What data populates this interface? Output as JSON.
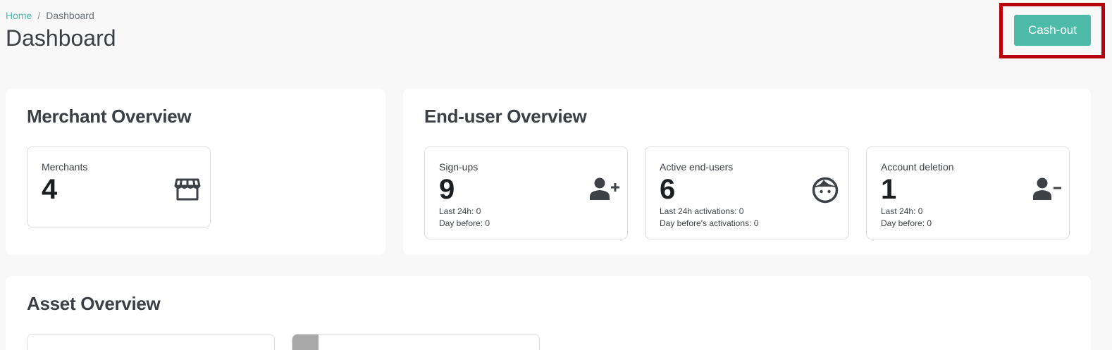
{
  "breadcrumb": {
    "home": "Home",
    "separator": "/",
    "current": "Dashboard"
  },
  "page_title": "Dashboard",
  "actions": {
    "cashout_label": "Cash-out"
  },
  "merchant_overview": {
    "title": "Merchant Overview",
    "cards": [
      {
        "label": "Merchants",
        "value": "4",
        "icon": "store-icon"
      }
    ]
  },
  "enduser_overview": {
    "title": "End-user Overview",
    "cards": [
      {
        "label": "Sign-ups",
        "value": "9",
        "line1": "Last 24h: 0",
        "line2": "Day before: 0",
        "icon": "user-add-icon"
      },
      {
        "label": "Active end-users",
        "value": "6",
        "line1": "Last 24h activations: 0",
        "line2": "Day before's activations: 0",
        "icon": "face-icon"
      },
      {
        "label": "Account deletion",
        "value": "1",
        "line1": "Last 24h: 0",
        "line2": "Day before: 0",
        "icon": "user-remove-icon"
      }
    ]
  },
  "asset_overview": {
    "title": "Asset Overview"
  },
  "colors": {
    "accent": "#4dbba8",
    "highlight": "#b5000b",
    "background": "#f8f8f8"
  }
}
